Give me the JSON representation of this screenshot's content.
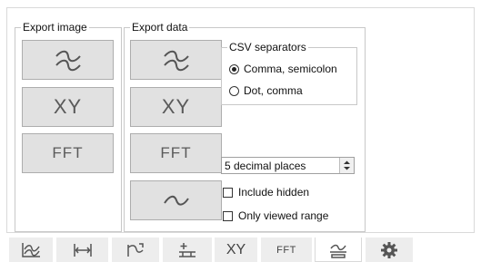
{
  "export_image": {
    "title": "Export image",
    "xy_label": "XY",
    "fft_label": "FFT"
  },
  "export_data": {
    "title": "Export data",
    "xy_label": "XY",
    "fft_label": "FFT"
  },
  "csv_separators": {
    "title": "CSV separators",
    "options": [
      {
        "label": "Comma, semicolon",
        "selected": true
      },
      {
        "label": "Dot, comma",
        "selected": false
      }
    ]
  },
  "decimal_places": {
    "value": "5 decimal places"
  },
  "checkboxes": [
    {
      "label": "Include hidden",
      "checked": false
    },
    {
      "label": "Only viewed range",
      "checked": false
    }
  ],
  "tabs": {
    "xy": "XY",
    "fft": "FFT",
    "active_tab": "export-tab"
  },
  "icons": [
    "waveform-icon",
    "horizontal-range-icon",
    "trigger-icon",
    "cursor-icon",
    "xy-tab",
    "fft-tab",
    "export-icon",
    "gear-icon"
  ]
}
